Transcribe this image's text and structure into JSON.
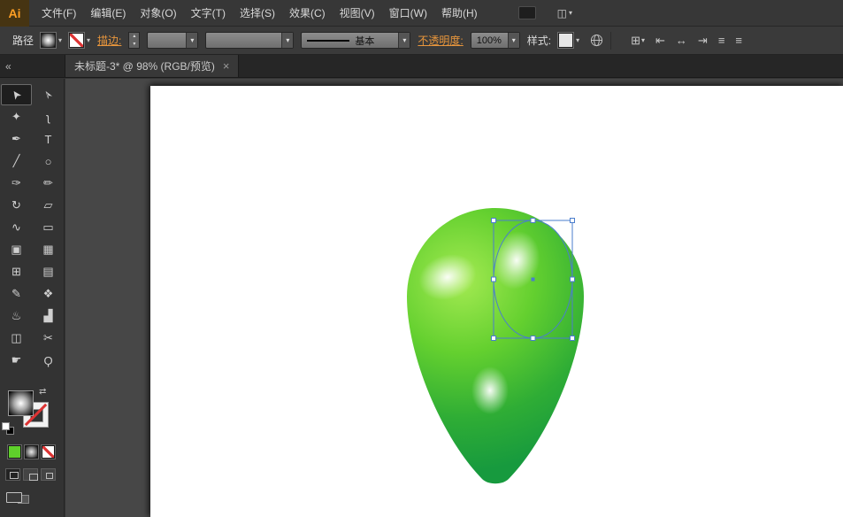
{
  "app": {
    "logo_text": "Ai"
  },
  "menu_bar": {
    "items": [
      "文件(F)",
      "编辑(E)",
      "对象(O)",
      "文字(T)",
      "选择(S)",
      "效果(C)",
      "视图(V)",
      "窗口(W)",
      "帮助(H)"
    ],
    "right_icons": {
      "arrange_documents_glyph": "◫"
    }
  },
  "control_bar": {
    "context_label": "路径",
    "stroke_link_label": "描边:",
    "brush_name": "基本",
    "opacity_link_label": "不透明度:",
    "opacity_value": "100%",
    "style_label": "样式:",
    "right_icons": {
      "transform": "⊞",
      "align_left": "⇤",
      "align_center": "↔",
      "align_right": "⇥",
      "menu1": "≡",
      "menu2": "≡"
    }
  },
  "tab_bar": {
    "title": "未标题-3* @ 98% (RGB/预览)"
  },
  "glyphs": {
    "caret": "▾",
    "stepper_up": "▴",
    "stepper_down": "▾",
    "collapse": "«",
    "close": "×",
    "swap": "⇄"
  },
  "tools": [
    {
      "name": "selection-tool",
      "glyph": "➤",
      "active": true,
      "rotate": true
    },
    {
      "name": "direct-selection-tool",
      "glyph": "➢",
      "rotate": true
    },
    {
      "name": "magic-wand-tool",
      "glyph": "✦"
    },
    {
      "name": "lasso-tool",
      "glyph": "ʅ"
    },
    {
      "name": "pen-tool",
      "glyph": "✒"
    },
    {
      "name": "type-tool",
      "glyph": "T"
    },
    {
      "name": "line-tool",
      "glyph": "╱"
    },
    {
      "name": "ellipse-tool",
      "glyph": "○"
    },
    {
      "name": "paintbrush-tool",
      "glyph": "✑"
    },
    {
      "name": "pencil-tool",
      "glyph": "✏"
    },
    {
      "name": "rotate-tool",
      "glyph": "↻"
    },
    {
      "name": "scale-tool",
      "glyph": "▱"
    },
    {
      "name": "width-tool",
      "glyph": "∿"
    },
    {
      "name": "free-transform-tool",
      "glyph": "▭"
    },
    {
      "name": "shape-builder-tool",
      "glyph": "▣"
    },
    {
      "name": "perspective-grid-tool",
      "glyph": "▦"
    },
    {
      "name": "mesh-tool",
      "glyph": "⊞"
    },
    {
      "name": "gradient-tool",
      "glyph": "▤"
    },
    {
      "name": "eyedropper-tool",
      "glyph": "✎"
    },
    {
      "name": "blend-tool",
      "glyph": "❖"
    },
    {
      "name": "symbol-sprayer-tool",
      "glyph": "♨"
    },
    {
      "name": "graph-tool",
      "glyph": "▟"
    },
    {
      "name": "artboard-tool",
      "glyph": "◫"
    },
    {
      "name": "slice-tool",
      "glyph": "✂"
    },
    {
      "name": "hand-tool",
      "glyph": "☛"
    },
    {
      "name": "zoom-tool",
      "glyph": "Ϙ"
    }
  ],
  "document": {
    "artboard_color": "#ffffff",
    "shape_description": "green egg shape with three soft white highlights, one highlight ellipse selected"
  },
  "colors": {
    "selection_blue": "#4a7dcd",
    "egg_gradient": [
      "#a4ea52",
      "#64d02f",
      "#2fad35",
      "#179a3e"
    ],
    "highlight": "#ffffff",
    "link_orange": "#e8963c",
    "logo_orange": "#ff9f24",
    "swatch_green": "#5fd02b"
  }
}
